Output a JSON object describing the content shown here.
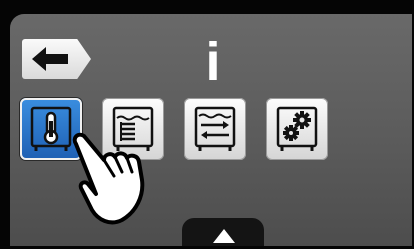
{
  "header": {
    "title": "i"
  },
  "menu": {
    "tiles": [
      {
        "id": "temperature",
        "icon": "thermometer-tank-icon",
        "selected": true
      },
      {
        "id": "water-level",
        "icon": "water-level-tank-icon",
        "selected": false
      },
      {
        "id": "flow",
        "icon": "flow-arrows-tank-icon",
        "selected": false
      },
      {
        "id": "settings",
        "icon": "gears-tank-icon",
        "selected": false
      }
    ]
  },
  "colors": {
    "accent": "#2f7fd6",
    "screen": "#626262",
    "tab": "#141414"
  }
}
